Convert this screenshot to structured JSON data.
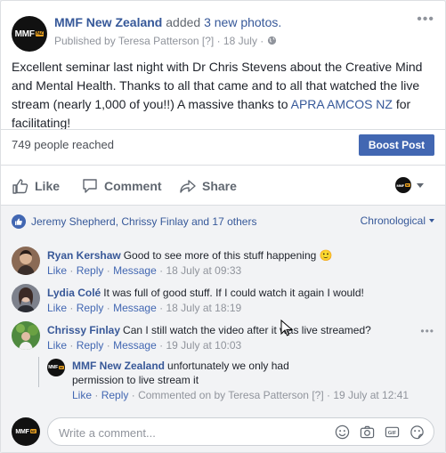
{
  "post": {
    "page_name": "MMF New Zealand",
    "action_text": "added",
    "photos_text": "3 new photos.",
    "published_by": "Published by Teresa Patterson",
    "bracket_q": "[?]",
    "dot": "·",
    "date": "18 July",
    "body_part1": "Excellent seminar last night with Dr Chris Stevens about the Creative Mind and Mental Health. Thanks to all that came and to all that watched the live stream (nearly 1,000 of you!!) A massive thanks to",
    "mention": "APRA AMCOS NZ",
    "body_part2": "for facilitating!",
    "avatar_text": "MMF",
    "avatar_badge": "NZ",
    "more_icon": "more-dots-icon"
  },
  "insights": {
    "reach": "749 people reached",
    "boost_label": "Boost Post"
  },
  "actions": {
    "like": "Like",
    "comment": "Comment",
    "share": "Share"
  },
  "reactions": {
    "text": "Jeremy Shepherd, Chrissy Finlay and 17 others",
    "sort": "Chronological"
  },
  "comments": [
    {
      "name": "Ryan Kershaw",
      "text": "Good to see more of this stuff happening",
      "emoji": "🙂",
      "like": "Like",
      "reply": "Reply",
      "message": "Message",
      "time": "18 July at 09:33",
      "avatar_color": "#7a5a46"
    },
    {
      "name": "Lydia Colé",
      "text": "It was full of good stuff. If I could watch it again I would!",
      "like": "Like",
      "reply": "Reply",
      "message": "Message",
      "time": "18 July at 18:19",
      "avatar_color": "#6b6f7a"
    },
    {
      "name": "Chrissy Finlay",
      "text": "Can I still watch the video after it was live streamed?",
      "like": "Like",
      "reply": "Reply",
      "message": "Message",
      "time": "19 July at 10:03",
      "avatar_color": "#3d7a3a"
    }
  ],
  "reply": {
    "name": "MMF New Zealand",
    "text": "unfortunately we only had permission to live stream it",
    "like": "Like",
    "reply": "Reply",
    "commented_on_by": "Commented on by Teresa Patterson",
    "bracket_q": "[?]",
    "time": "19 July at 12:41"
  },
  "composer": {
    "placeholder": "Write a comment..."
  },
  "meta": {
    "dot": "·"
  }
}
